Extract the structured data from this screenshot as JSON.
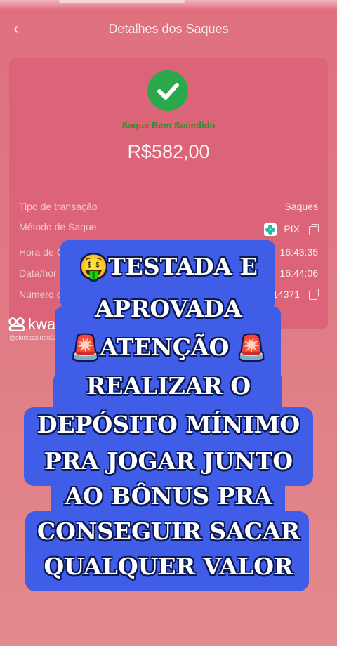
{
  "header": {
    "back_glyph": "‹",
    "title": "Detalhes dos Saques"
  },
  "receipt": {
    "status": "Saque Bem Sucedido",
    "amount": "R$582,00",
    "rows": [
      {
        "label": "Tipo de transação",
        "value": "Saques"
      },
      {
        "label": "Método de Saque",
        "value": "PIX"
      },
      {
        "label": "Hora de C",
        "value": "16:43:35"
      },
      {
        "label": "Data/hor",
        "value": "16:44:06"
      },
      {
        "label": "Número c",
        "value": "14371"
      }
    ]
  },
  "watermark": {
    "brand": "kwai",
    "user": "@slotscasinos037"
  },
  "overlay": {
    "lines": [
      "🤑TESTADA E",
      "APROVADA",
      "🚨ATENÇÃO 🚨",
      "REALIZAR O",
      "DEPÓSITO MÍNIMO",
      "PRA JOGAR JUNTO",
      "AO BÔNUS PRA",
      "CONSEGUIR SACAR",
      "QUALQUER VALOR"
    ],
    "highlight_color": "#3f5de6"
  },
  "colors": {
    "success": "#2aa84b",
    "card": "#dc6478"
  },
  "icons": [
    "back-chevron-icon",
    "success-check-icon",
    "pix-icon",
    "copy-icon",
    "kwai-logo-icon",
    "money-face-emoji",
    "siren-emoji"
  ]
}
